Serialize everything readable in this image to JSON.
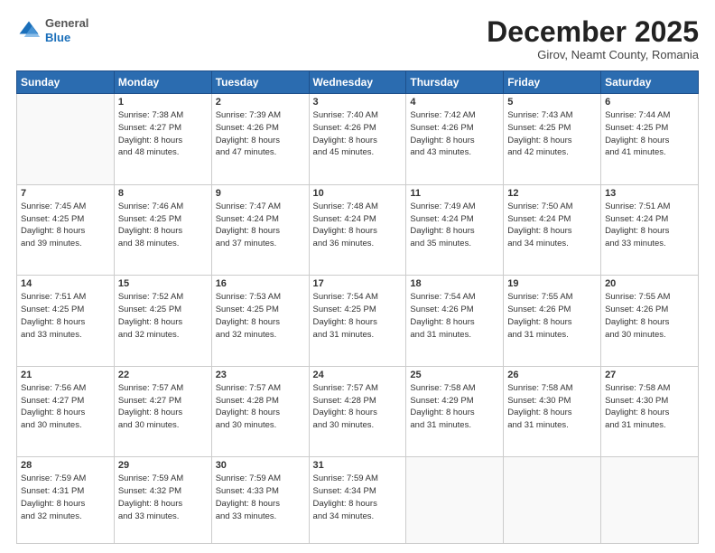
{
  "header": {
    "logo_general": "General",
    "logo_blue": "Blue",
    "month_title": "December 2025",
    "subtitle": "Girov, Neamt County, Romania"
  },
  "days_of_week": [
    "Sunday",
    "Monday",
    "Tuesday",
    "Wednesday",
    "Thursday",
    "Friday",
    "Saturday"
  ],
  "weeks": [
    [
      {
        "day": "",
        "text": ""
      },
      {
        "day": "1",
        "text": "Sunrise: 7:38 AM\nSunset: 4:27 PM\nDaylight: 8 hours\nand 48 minutes."
      },
      {
        "day": "2",
        "text": "Sunrise: 7:39 AM\nSunset: 4:26 PM\nDaylight: 8 hours\nand 47 minutes."
      },
      {
        "day": "3",
        "text": "Sunrise: 7:40 AM\nSunset: 4:26 PM\nDaylight: 8 hours\nand 45 minutes."
      },
      {
        "day": "4",
        "text": "Sunrise: 7:42 AM\nSunset: 4:26 PM\nDaylight: 8 hours\nand 43 minutes."
      },
      {
        "day": "5",
        "text": "Sunrise: 7:43 AM\nSunset: 4:25 PM\nDaylight: 8 hours\nand 42 minutes."
      },
      {
        "day": "6",
        "text": "Sunrise: 7:44 AM\nSunset: 4:25 PM\nDaylight: 8 hours\nand 41 minutes."
      }
    ],
    [
      {
        "day": "7",
        "text": "Sunrise: 7:45 AM\nSunset: 4:25 PM\nDaylight: 8 hours\nand 39 minutes."
      },
      {
        "day": "8",
        "text": "Sunrise: 7:46 AM\nSunset: 4:25 PM\nDaylight: 8 hours\nand 38 minutes."
      },
      {
        "day": "9",
        "text": "Sunrise: 7:47 AM\nSunset: 4:24 PM\nDaylight: 8 hours\nand 37 minutes."
      },
      {
        "day": "10",
        "text": "Sunrise: 7:48 AM\nSunset: 4:24 PM\nDaylight: 8 hours\nand 36 minutes."
      },
      {
        "day": "11",
        "text": "Sunrise: 7:49 AM\nSunset: 4:24 PM\nDaylight: 8 hours\nand 35 minutes."
      },
      {
        "day": "12",
        "text": "Sunrise: 7:50 AM\nSunset: 4:24 PM\nDaylight: 8 hours\nand 34 minutes."
      },
      {
        "day": "13",
        "text": "Sunrise: 7:51 AM\nSunset: 4:24 PM\nDaylight: 8 hours\nand 33 minutes."
      }
    ],
    [
      {
        "day": "14",
        "text": "Sunrise: 7:51 AM\nSunset: 4:25 PM\nDaylight: 8 hours\nand 33 minutes."
      },
      {
        "day": "15",
        "text": "Sunrise: 7:52 AM\nSunset: 4:25 PM\nDaylight: 8 hours\nand 32 minutes."
      },
      {
        "day": "16",
        "text": "Sunrise: 7:53 AM\nSunset: 4:25 PM\nDaylight: 8 hours\nand 32 minutes."
      },
      {
        "day": "17",
        "text": "Sunrise: 7:54 AM\nSunset: 4:25 PM\nDaylight: 8 hours\nand 31 minutes."
      },
      {
        "day": "18",
        "text": "Sunrise: 7:54 AM\nSunset: 4:26 PM\nDaylight: 8 hours\nand 31 minutes."
      },
      {
        "day": "19",
        "text": "Sunrise: 7:55 AM\nSunset: 4:26 PM\nDaylight: 8 hours\nand 31 minutes."
      },
      {
        "day": "20",
        "text": "Sunrise: 7:55 AM\nSunset: 4:26 PM\nDaylight: 8 hours\nand 30 minutes."
      }
    ],
    [
      {
        "day": "21",
        "text": "Sunrise: 7:56 AM\nSunset: 4:27 PM\nDaylight: 8 hours\nand 30 minutes."
      },
      {
        "day": "22",
        "text": "Sunrise: 7:57 AM\nSunset: 4:27 PM\nDaylight: 8 hours\nand 30 minutes."
      },
      {
        "day": "23",
        "text": "Sunrise: 7:57 AM\nSunset: 4:28 PM\nDaylight: 8 hours\nand 30 minutes."
      },
      {
        "day": "24",
        "text": "Sunrise: 7:57 AM\nSunset: 4:28 PM\nDaylight: 8 hours\nand 30 minutes."
      },
      {
        "day": "25",
        "text": "Sunrise: 7:58 AM\nSunset: 4:29 PM\nDaylight: 8 hours\nand 31 minutes."
      },
      {
        "day": "26",
        "text": "Sunrise: 7:58 AM\nSunset: 4:30 PM\nDaylight: 8 hours\nand 31 minutes."
      },
      {
        "day": "27",
        "text": "Sunrise: 7:58 AM\nSunset: 4:30 PM\nDaylight: 8 hours\nand 31 minutes."
      }
    ],
    [
      {
        "day": "28",
        "text": "Sunrise: 7:59 AM\nSunset: 4:31 PM\nDaylight: 8 hours\nand 32 minutes."
      },
      {
        "day": "29",
        "text": "Sunrise: 7:59 AM\nSunset: 4:32 PM\nDaylight: 8 hours\nand 33 minutes."
      },
      {
        "day": "30",
        "text": "Sunrise: 7:59 AM\nSunset: 4:33 PM\nDaylight: 8 hours\nand 33 minutes."
      },
      {
        "day": "31",
        "text": "Sunrise: 7:59 AM\nSunset: 4:34 PM\nDaylight: 8 hours\nand 34 minutes."
      },
      {
        "day": "",
        "text": ""
      },
      {
        "day": "",
        "text": ""
      },
      {
        "day": "",
        "text": ""
      }
    ]
  ]
}
